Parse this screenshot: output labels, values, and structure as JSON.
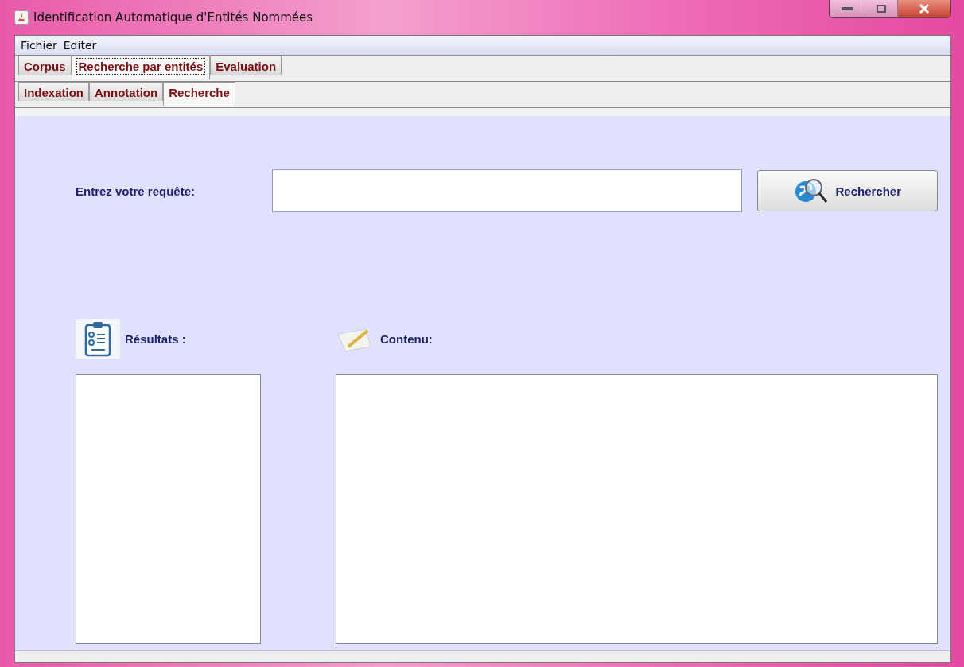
{
  "window": {
    "title": "Identification Automatique d'Entités Nommées"
  },
  "menu": [
    "Fichier",
    "Editer"
  ],
  "tabs": [
    {
      "label": "Corpus",
      "selected": false
    },
    {
      "label": "Recherche par entités",
      "selected": true
    },
    {
      "label": "Evaluation",
      "selected": false
    }
  ],
  "subtabs": [
    {
      "label": "Indexation",
      "selected": false
    },
    {
      "label": "Annotation",
      "selected": false
    },
    {
      "label": "Recherche",
      "selected": true
    }
  ],
  "search": {
    "label": "Entrez votre requête:",
    "button": "Rechercher"
  },
  "results": {
    "label": "Résultats :"
  },
  "content": {
    "label": "Contenu:"
  }
}
